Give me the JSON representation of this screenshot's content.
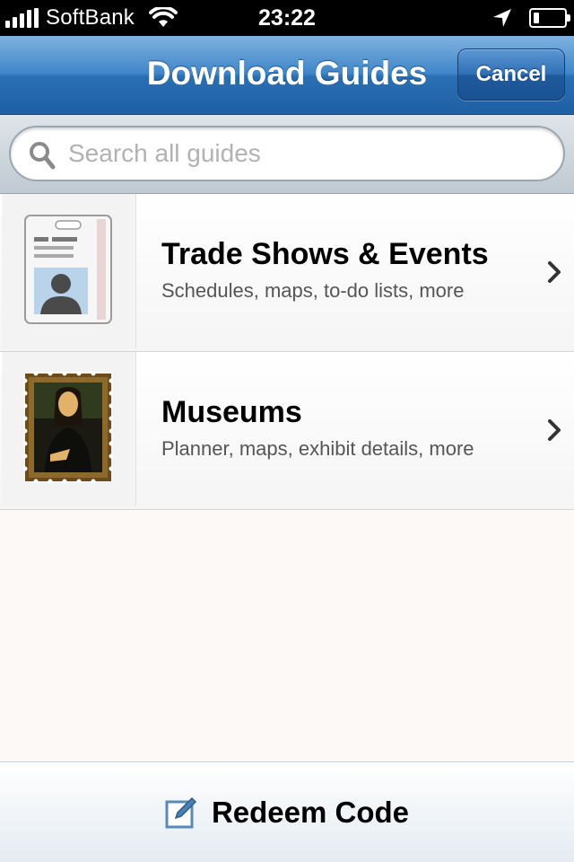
{
  "status_bar": {
    "carrier": "SoftBank",
    "time": "23:22",
    "signal_icon": "signal-bars-icon",
    "wifi_icon": "wifi-icon",
    "location_icon": "location-arrow-icon",
    "battery_icon": "battery-icon",
    "battery_level": 0.2
  },
  "nav": {
    "title": "Download Guides",
    "cancel_label": "Cancel"
  },
  "search": {
    "placeholder": "Search all guides",
    "value": ""
  },
  "guides": [
    {
      "title": "Trade Shows & Events",
      "subtitle": "Schedules, maps, to-do lists, more",
      "icon": "badge-icon"
    },
    {
      "title": "Museums",
      "subtitle": "Planner, maps, exhibit details, more",
      "icon": "mona-lisa-stamp-icon"
    }
  ],
  "footer": {
    "redeem_label": "Redeem Code",
    "redeem_icon": "edit-pencil-icon"
  },
  "colors": {
    "nav_blue": "#2a6fb4",
    "content_background": "#fdf9f6",
    "subtitle_gray": "#555555"
  }
}
